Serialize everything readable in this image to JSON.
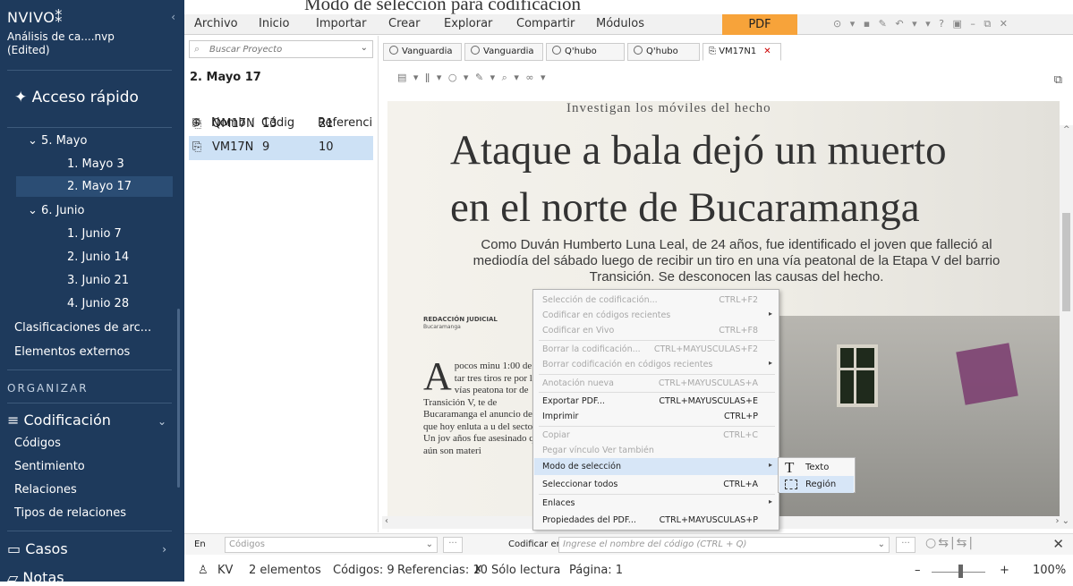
{
  "top_caption": "Modo de selección para codificación",
  "app": {
    "brand": "NVIVO",
    "brand_mark": "⁑",
    "project": "Análisis de ca....nvp",
    "project_state": "(Edited)"
  },
  "sidebar": {
    "quick_access": "Acceso rápido",
    "tree": [
      {
        "label": "5. Mayo",
        "expandable": true
      },
      {
        "label": "1. Mayo 3"
      },
      {
        "label": "2. Mayo 17",
        "selected": true
      },
      {
        "label": "6. Junio",
        "expandable": true
      },
      {
        "label": "1. Junio 7"
      },
      {
        "label": "2. Junio 14"
      },
      {
        "label": "3. Junio 21"
      },
      {
        "label": "4. Junio 28"
      },
      {
        "label": "Clasificaciones de arc..."
      },
      {
        "label": "Elementos externos"
      }
    ],
    "organize": "ORGANIZAR",
    "coding_section": "Codificación",
    "coding_items": [
      "Códigos",
      "Sentimiento",
      "Relaciones",
      "Tipos de relaciones"
    ],
    "cases_section": "Casos",
    "notes_section": "Notas"
  },
  "ribbon": {
    "menu": [
      "Archivo",
      "Inicio",
      "Importar",
      "Crear",
      "Explorar",
      "Compartir",
      "Módulos"
    ],
    "active_tab": "PDF",
    "quick_icons": "⊙ ▾ ▪ ✎ ↶ ▾ ▾ ? ▣ – ⧉ ✕"
  },
  "list_panel": {
    "search_placeholder": "Buscar Proyecto",
    "folder_title": "2. Mayo 17",
    "columns": [
      "Nomb",
      "Códig",
      "Referenci"
    ],
    "rows": [
      {
        "name": "QM17N",
        "codes": "13",
        "refs": "21"
      },
      {
        "name": "VM17N",
        "codes": "9",
        "refs": "10",
        "selected": true
      }
    ]
  },
  "doc_tabs": [
    {
      "label": "Vanguardia"
    },
    {
      "label": "Vanguardia"
    },
    {
      "label": "Q'hubo"
    },
    {
      "label": "Q'hubo"
    },
    {
      "label": "VM17N1",
      "active": true
    }
  ],
  "doc_toolbar": "▤ ▾  ǁ ▾  ○ ▾  ✎ ▾  ⌕ ▾  ∞ ▾",
  "pdf": {
    "kicker": "Investigan los móviles del hecho",
    "headline_line1": "Ataque a bala dejó un muerto",
    "headline_line2": "en el norte de Bucaramanga",
    "deck": "Como Duván Humberto Luna Leal, de 24 años, fue identificado el joven que falleció al mediodía del sábado luego de recibir un tiro en una vía peatonal de la Etapa V del barrio Transición. Se desconocen las causas del hecho.",
    "byline": "REDACCIÓN JUDICIAL",
    "byline_city": "Bucaramanga",
    "dropcap": "A",
    "body": "pocos minu 1:00 de la tar tres tiros re por las vías peatona tor de Transición V, te de Bucaramanga el anuncio de un que hoy enluta a u del sector. Un jov años fue asesinado que aún son materi"
  },
  "context_menu": {
    "items": [
      {
        "label": "Selección de codificación...",
        "shortcut": "CTRL+F2",
        "disabled": true
      },
      {
        "label": "Codificar en códigos recientes",
        "submenu": true,
        "disabled": true
      },
      {
        "label": "Codificar en Vivo",
        "shortcut": "CTRL+F8",
        "disabled": true
      },
      {
        "label": "Borrar la codificación...",
        "shortcut": "CTRL+MAYUSCULAS+F2",
        "disabled": true
      },
      {
        "label": "Borrar codificación en códigos recientes",
        "submenu": true,
        "disabled": true
      },
      {
        "label": "Anotación nueva",
        "shortcut": "CTRL+MAYUSCULAS+A",
        "disabled": true
      },
      {
        "label": "Exportar PDF...",
        "shortcut": "CTRL+MAYUSCULAS+E"
      },
      {
        "label": "Imprimir",
        "shortcut": "CTRL+P"
      },
      {
        "label": "Copiar",
        "shortcut": "CTRL+C",
        "disabled": true
      },
      {
        "label": "Pegar vínculo Ver también",
        "disabled": true
      },
      {
        "label": "Modo de selección",
        "submenu": true,
        "highlighted": true
      },
      {
        "label": "Seleccionar todos",
        "shortcut": "CTRL+A"
      },
      {
        "label": "Enlaces",
        "submenu": true
      },
      {
        "label": "Propiedades del PDF...",
        "shortcut": "CTRL+MAYUSCULAS+P"
      }
    ]
  },
  "submenu": {
    "items": [
      {
        "label": "Texto",
        "icon": "text-cursor-icon"
      },
      {
        "label": "Región",
        "icon": "region-select-icon",
        "highlighted": true
      }
    ]
  },
  "coding_bar": {
    "in_label": "En",
    "in_placeholder": "Códigos",
    "code_in_label": "Codificar en",
    "code_in_placeholder": "Ingrese el nombre del código (CTRL + Q)",
    "dots": "···"
  },
  "status": {
    "user": "KV",
    "items": "2 elementos",
    "codes": "Códigos: 9",
    "refs": "Referencias: 10",
    "readonly": "Sólo lectura",
    "page": "Página: 1",
    "zoom_minus": "–",
    "zoom_plus": "+",
    "zoom_level": "100%"
  }
}
